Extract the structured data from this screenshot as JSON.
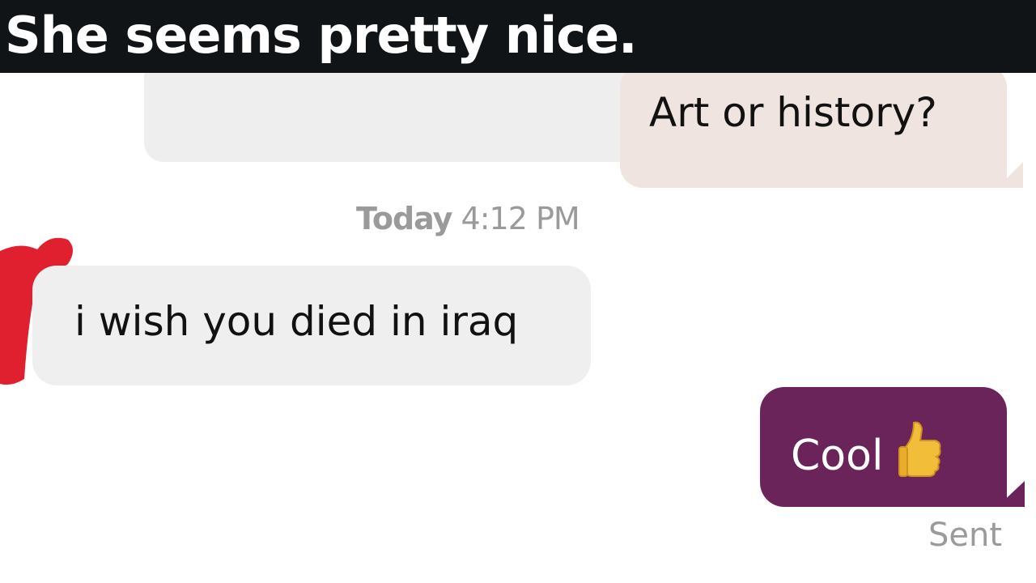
{
  "caption": {
    "text": "She seems pretty nice."
  },
  "messages": [
    {
      "direction": "outgoing",
      "text": "Art or history?"
    },
    {
      "direction": "incoming",
      "text": "i wish you died in iraq"
    },
    {
      "direction": "outgoing",
      "text": "Cool",
      "emoji": "thumbs-up-icon"
    }
  ],
  "timestamp": {
    "day": "Today",
    "time": "4:12",
    "period": "PM"
  },
  "status": "Sent",
  "colors": {
    "caption_bar": "#111417",
    "outgoing_light": "#efe4df",
    "outgoing_dark": "#6b2459",
    "incoming": "#efefef",
    "meta_text": "#9a9a9a",
    "redaction": "#e0202e"
  }
}
